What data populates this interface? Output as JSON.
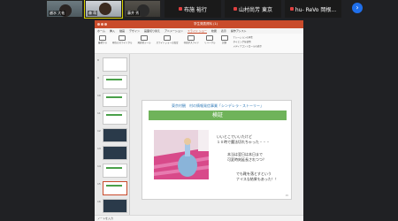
{
  "zoom": {
    "participants": [
      {
        "name": "越水 大祐"
      },
      {
        "name": "森 萌"
      },
      {
        "name": "藤井 秀"
      }
    ],
    "named_tiles": [
      {
        "name": "布施 裕行"
      },
      {
        "name": "山村尚芳 東京"
      },
      {
        "name": "hu- ReVo 岡根..."
      }
    ],
    "next_label": "›"
  },
  "ppt": {
    "window_title": "学生発表資料 (1)",
    "tabs": [
      "ホーム",
      "挿入",
      "描画",
      "デザイン",
      "画面切り替え",
      "アニメーション",
      "スライド ショー",
      "校閲",
      "表示",
      "操作アシスト"
    ],
    "active_tab": "スライド ショー",
    "ribbon": [
      {
        "label": "最初から"
      },
      {
        "label": "現在のスライドから"
      },
      {
        "label": "発表者ツール"
      },
      {
        "label": "スライドショーの設定"
      },
      {
        "label": "非表示スライド"
      },
      {
        "label": "リハーサル"
      },
      {
        "label": "記録"
      }
    ],
    "ribbon_checks": [
      "ナレーションの再生",
      "タイミングを使用",
      "メディアコントロールの表示"
    ],
    "thumb_numbers": [
      "8",
      "9",
      "10",
      "11",
      "12",
      "13",
      "14",
      "15",
      "16"
    ],
    "status_text": "ノートを入力"
  },
  "slide": {
    "title": "東京村観　村の情報発信事業「シンデレラ・ストーリー」",
    "banner": "検証",
    "text1": "いいとこでいいたけど",
    "text2": "１０時で魔法切れちゃった・・・",
    "text3": "本当は翌日は本日まで",
    "text4": "可変時刻延長されつつ？",
    "text5": "でも靴を落とすという",
    "text6": "ナイスな結果もあった！！",
    "page": "15"
  },
  "colors": {
    "title_bar": "#c94b2b",
    "banner": "#6fb35a",
    "title_text": "#2f7ab8"
  }
}
